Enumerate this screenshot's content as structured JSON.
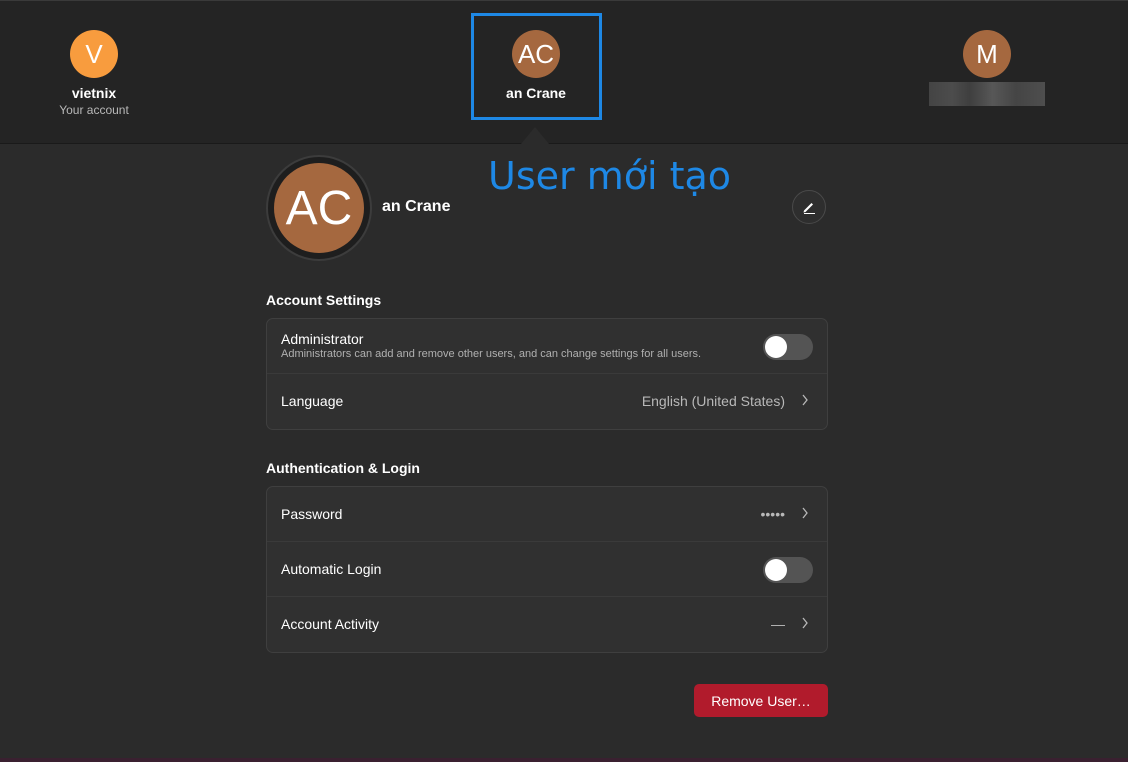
{
  "users": [
    {
      "initial": "V",
      "name": "vietnix",
      "subtitle": "Your account",
      "color": "#f89c3e"
    },
    {
      "initial": "AC",
      "name": "an Crane",
      "subtitle": "",
      "color": "#a5683f"
    },
    {
      "initial": "M",
      "name": "",
      "subtitle": "",
      "color": "#a5683f"
    }
  ],
  "annotation": "User mới tạo",
  "profile": {
    "initials": "AC",
    "name": "an Crane"
  },
  "account_settings": {
    "title": "Account Settings",
    "administrator_label": "Administrator",
    "administrator_desc": "Administrators can add and remove other users, and can change settings for all users.",
    "administrator_on": false,
    "language_label": "Language",
    "language_value": "English (United States)"
  },
  "auth": {
    "title": "Authentication & Login",
    "password_label": "Password",
    "password_value": "•••••",
    "auto_login_label": "Automatic Login",
    "auto_login_on": false,
    "activity_label": "Account Activity",
    "activity_value": "—"
  },
  "remove_button": "Remove User…",
  "icons": {
    "edit": "pencil-icon",
    "chevron": "chevron-right-icon"
  }
}
